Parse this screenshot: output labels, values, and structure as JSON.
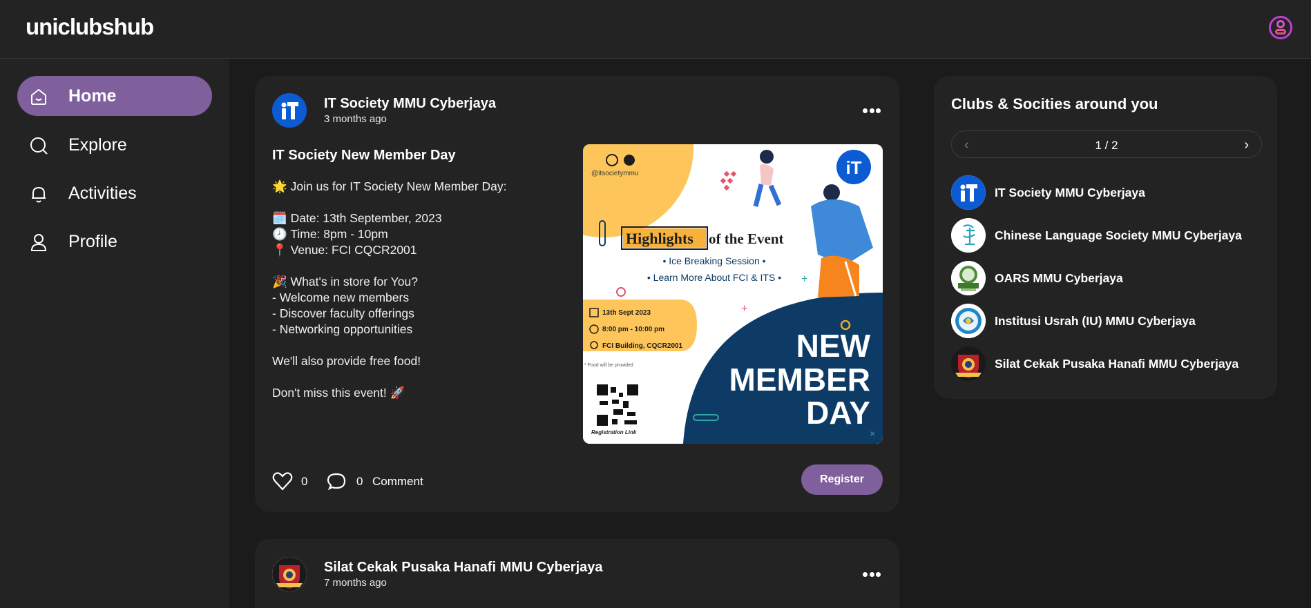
{
  "app": {
    "logo": "uniclubshub"
  },
  "header": {
    "user_icon": "user-circle-icon"
  },
  "sidebar": {
    "items": [
      {
        "label": "Home",
        "icon": "home-icon",
        "active": true
      },
      {
        "label": "Explore",
        "icon": "search-icon",
        "active": false
      },
      {
        "label": "Activities",
        "icon": "bell-icon",
        "active": false
      },
      {
        "label": "Profile",
        "icon": "user-icon",
        "active": false
      }
    ]
  },
  "posts": [
    {
      "club": "IT Society MMU Cyberjaya",
      "time": "3 months ago",
      "title": "IT Society New Member Day",
      "body": [
        "🌟 Join us for IT Society New Member Day:",
        "",
        "🗓️ Date: 13th September, 2023",
        "🕗 Time: 8pm - 10pm",
        "📍 Venue: FCI CQCR2001",
        "",
        "🎉 What's in store for You?",
        "- Welcome new members",
        "- Discover faculty offerings",
        "- Networking opportunities",
        "",
        "We'll also provide free food!",
        "",
        "Don't miss this event! 🚀"
      ],
      "poster": {
        "handle": "@itsocietymmu",
        "highlight_word": "Highlights",
        "highlight_rest": "of the Event",
        "bullet1": "• Ice Breaking Session •",
        "bullet2": "• Learn More About FCI & ITS •",
        "date": "13th Sept 2023",
        "time": "8:00 pm - 10:00 pm",
        "venue": "FCI Building, CQCR2001",
        "food_note": "* Food will be provided",
        "qr_label": "Registration Link",
        "big1": "NEW",
        "big2": "MEMBER",
        "big3": "DAY",
        "badge": "iT"
      },
      "likes": "0",
      "comments": "0",
      "comment_label": "Comment",
      "register_label": "Register"
    },
    {
      "club": "Silat Cekak Pusaka Hanafi MMU Cyberjaya",
      "time": "7 months ago"
    }
  ],
  "right_panel": {
    "title": "Clubs & Socities around you",
    "page": "1 / 2",
    "clubs": [
      {
        "name": "IT Society MMU Cyberjaya"
      },
      {
        "name": "Chinese Language Society MMU Cyberjaya"
      },
      {
        "name": "OARS MMU Cyberjaya"
      },
      {
        "name": "Institusi Usrah (IU) MMU Cyberjaya"
      },
      {
        "name": "Silat Cekak Pusaka Hanafi MMU Cyberjaya"
      }
    ]
  },
  "colors": {
    "accent": "#7f5f9c",
    "background": "#1b1b1b",
    "surface": "#232323",
    "it_blue": "#0b5bd3",
    "poster_navy": "#0d3b66",
    "poster_yellow": "#fdc55a"
  }
}
